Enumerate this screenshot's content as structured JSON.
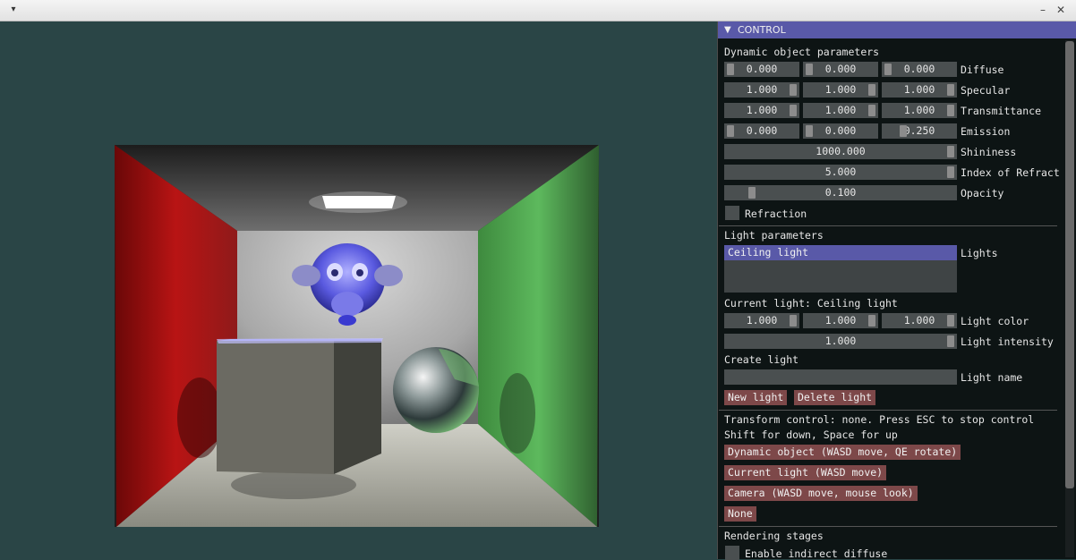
{
  "titlebar": {
    "menu_glyph": "▾",
    "minimize_glyph": "–",
    "maximize_glyph": "□",
    "close_glyph": "✕"
  },
  "panel": {
    "title": "CONTROL",
    "collapse_glyph": "▼"
  },
  "dynamic_object": {
    "header": "Dynamic object parameters",
    "diffuse": {
      "values": [
        "0.000",
        "0.000",
        "0.000"
      ],
      "label": "Diffuse"
    },
    "specular": {
      "values": [
        "1.000",
        "1.000",
        "1.000"
      ],
      "label": "Specular"
    },
    "transmittance": {
      "values": [
        "1.000",
        "1.000",
        "1.000"
      ],
      "label": "Transmittance"
    },
    "emission": {
      "values": [
        "0.000",
        "0.000",
        "0.250"
      ],
      "label": "Emission"
    },
    "shininess": {
      "value": "1000.000",
      "label": "Shininess"
    },
    "ior": {
      "value": "5.000",
      "label": "Index of Refract"
    },
    "opacity": {
      "value": "0.100",
      "label": "Opacity"
    },
    "refraction_label": "Refraction"
  },
  "light_params": {
    "header": "Light parameters",
    "lights_label": "Lights",
    "lights": [
      "Ceiling light"
    ],
    "current_light": "Current light: Ceiling light",
    "light_color": {
      "values": [
        "1.000",
        "1.000",
        "1.000"
      ],
      "label": "Light color"
    },
    "light_intensity": {
      "value": "1.000",
      "label": "Light intensity"
    },
    "create_light": "Create light",
    "light_name_label": "Light name",
    "light_name_value": "",
    "new_light": "New light",
    "delete_light": "Delete light"
  },
  "transform": {
    "status": "Transform control: none. Press ESC to stop control",
    "hint": "Shift for down, Space for up",
    "dynamic_object": "Dynamic object (WASD move, QE rotate)",
    "current_light": "Current light (WASD move)",
    "camera": "Camera (WASD move, mouse look)",
    "none": "None"
  },
  "rendering": {
    "header": "Rendering stages",
    "indirect_diffuse": "Enable indirect diffuse"
  },
  "colors": {
    "background": "#2a4546",
    "panel_bg": "#0d1414",
    "title_bar": "#5959a8",
    "field": "#4a4f50",
    "button": "#7d4849",
    "selection": "#5959a8"
  }
}
